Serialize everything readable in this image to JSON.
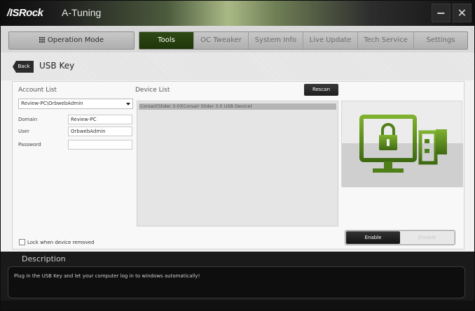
{
  "window": {
    "brand": "/ISRock",
    "title": "A-Tuning",
    "minimize_glyph": "−",
    "close_glyph": "✕"
  },
  "menu": {
    "operation_mode": "Operation Mode",
    "tabs": [
      {
        "label": "Tools",
        "active": true
      },
      {
        "label": "OC Tweaker",
        "active": false
      },
      {
        "label": "System Info",
        "active": false
      },
      {
        "label": "Live Update",
        "active": false
      },
      {
        "label": "Tech Service",
        "active": false
      },
      {
        "label": "Settings",
        "active": false
      }
    ]
  },
  "page": {
    "back_label": "Back",
    "title": "USB Key"
  },
  "account": {
    "label": "Account List",
    "selected": "Review-PC\\OrbwebAdmin",
    "domain_label": "Domain",
    "domain_value": "Review-PC",
    "user_label": "User",
    "user_value": "OrbwebAdmin",
    "password_label": "Password",
    "password_value": ""
  },
  "devices": {
    "label": "Device List",
    "rescan_label": "Rescan",
    "items": [
      "Corsair[Slider 3.0](Corsair Slider 3.0 USB Device)"
    ]
  },
  "toggle": {
    "enable_label": "Enable",
    "disable_label": "Disable",
    "state": "enable"
  },
  "lock": {
    "label": "Lock when device removed",
    "checked": false
  },
  "description": {
    "title": "Description",
    "text": "Plug in the USB Key and let your computer log in to windows automatically!"
  },
  "colors": {
    "accent_green": "#5f8f1f",
    "active_tab": "#2e4a14",
    "dark_button": "#1e1e1e"
  }
}
